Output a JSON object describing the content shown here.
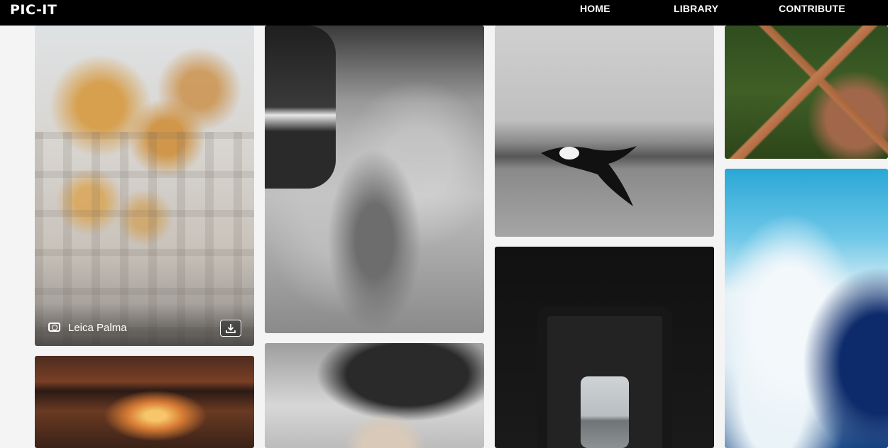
{
  "navbar": {
    "logo": "PIC-IT",
    "links": [
      {
        "label": "HOME"
      },
      {
        "label": "LIBRARY"
      },
      {
        "label": "CONTRIBUTE"
      }
    ]
  },
  "gallery": {
    "featured_card": {
      "photographer": "Leica Palma",
      "icons": [
        "camera-icon",
        "download-icon"
      ]
    },
    "images": [
      "tree-building-photo",
      "canyon-arch-photo",
      "dancer-fabric-photo",
      "woman-portrait-photo",
      "eagle-flight-photo",
      "tunnel-window-photo",
      "aerial-road-photo",
      "ocean-wave-photo"
    ]
  },
  "colors": {
    "navbar_bg": "#000000",
    "nav_text": "#ffffff",
    "page_bg": "#f4f4f4"
  }
}
